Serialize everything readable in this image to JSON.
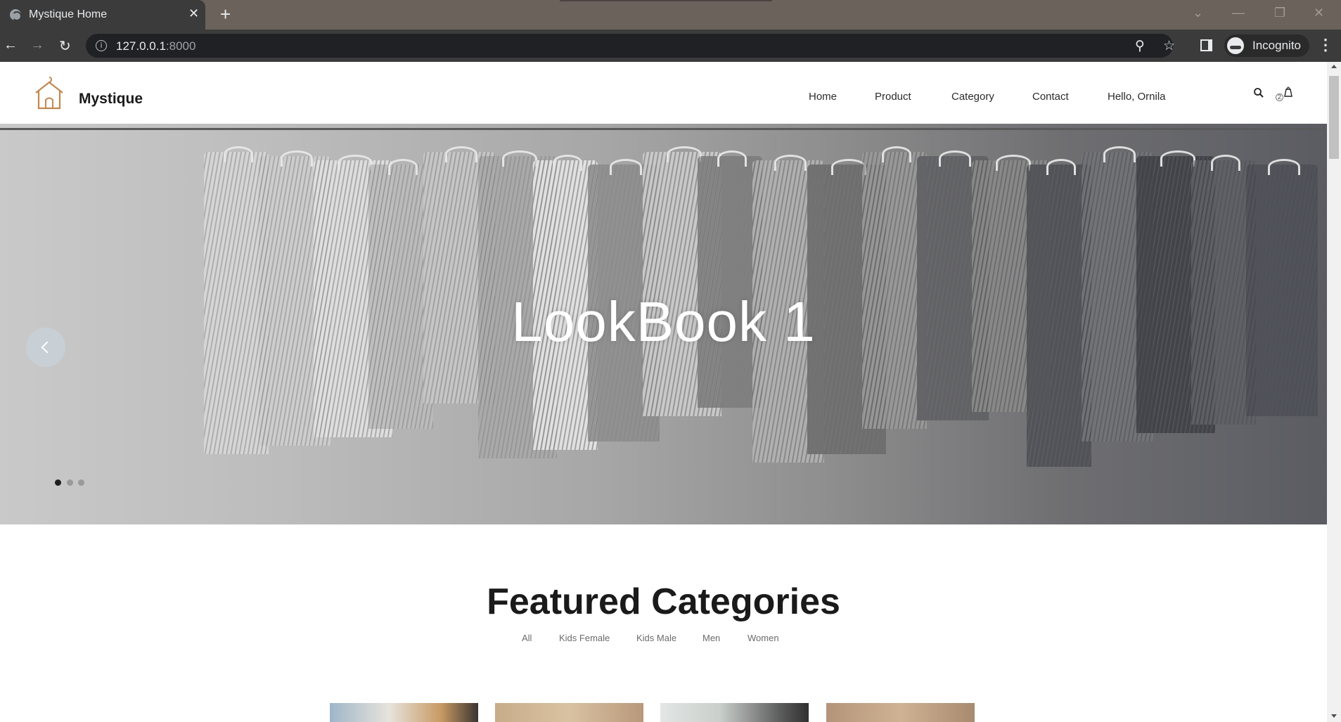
{
  "browser": {
    "tab_title": "Mystique Home",
    "url_host": "127.0.0.1",
    "url_port": ":8000",
    "profile_label": "Incognito"
  },
  "site": {
    "brand": "Mystique",
    "nav": [
      "Home",
      "Product",
      "Category",
      "Contact",
      "Hello, Ornila"
    ],
    "cart_count": "2"
  },
  "hero": {
    "title": "LookBook 1",
    "slides_total": 3,
    "active_slide": 1
  },
  "featured": {
    "title": "Featured Categories",
    "filters": [
      "All",
      "Kids Female",
      "Kids Male",
      "Men",
      "Women"
    ]
  },
  "colors": {
    "accent_logo": "#c2884f",
    "chrome_tabbar": "#6b625b",
    "chrome_toolbar": "#3b3b3b"
  }
}
